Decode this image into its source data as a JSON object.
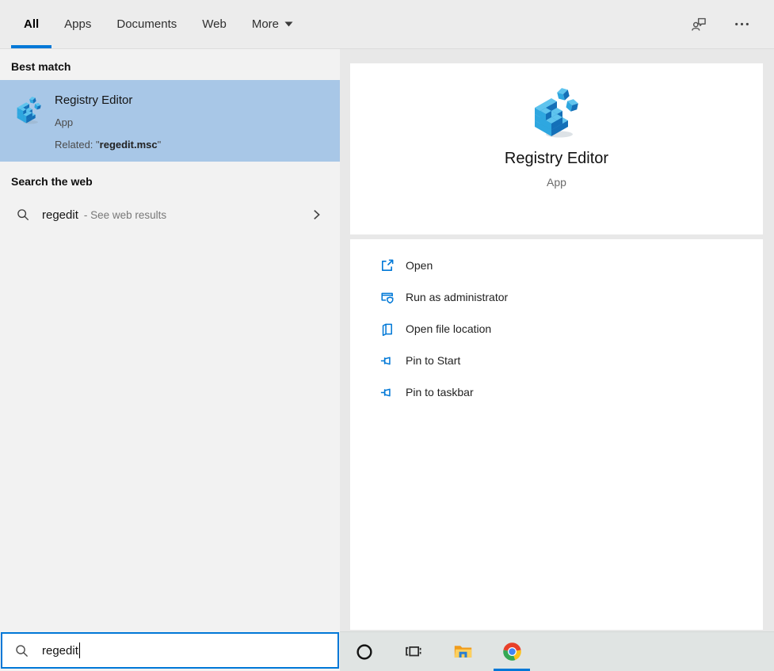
{
  "topbar": {
    "tabs": [
      {
        "label": "All",
        "active": true
      },
      {
        "label": "Apps",
        "active": false
      },
      {
        "label": "Documents",
        "active": false
      },
      {
        "label": "Web",
        "active": false
      },
      {
        "label": "More",
        "active": false,
        "has_dropdown": true
      }
    ],
    "action_icons": [
      "feedback-icon",
      "ellipsis-icon"
    ]
  },
  "left_panel": {
    "best_match_header": "Best match",
    "best_match": {
      "icon": "registry-editor-icon",
      "title": "Registry Editor",
      "subtitle": "App",
      "related_prefix": "Related: \"",
      "related_match": "regedit.msc",
      "related_suffix": "\""
    },
    "web_header": "Search the web",
    "web_row": {
      "icon": "search-icon",
      "query": "regedit",
      "hint": "- See web results",
      "chevron": "chevron-right-icon"
    }
  },
  "right_panel": {
    "app_icon": "registry-editor-icon",
    "app_name": "Registry Editor",
    "app_type": "App",
    "actions": [
      {
        "icon": "open-external-icon",
        "label": "Open"
      },
      {
        "icon": "run-as-admin-shield-icon",
        "label": "Run as administrator"
      },
      {
        "icon": "file-location-icon",
        "label": "Open file location"
      },
      {
        "icon": "pin-icon",
        "label": "Pin to Start"
      },
      {
        "icon": "pin-icon",
        "label": "Pin to taskbar"
      }
    ]
  },
  "search_bar": {
    "icon": "search-icon",
    "value": "regedit"
  },
  "taskbar": {
    "buttons": [
      {
        "icon": "cortana-icon",
        "active": false
      },
      {
        "icon": "task-view-icon",
        "active": false
      },
      {
        "icon": "file-explorer-icon",
        "active": false
      },
      {
        "icon": "chrome-icon",
        "active": true
      }
    ]
  },
  "colors": {
    "accent": "#0078d7",
    "best_match_highlight": "#a8c7e7",
    "action_icon_blue": "#0078d7"
  }
}
